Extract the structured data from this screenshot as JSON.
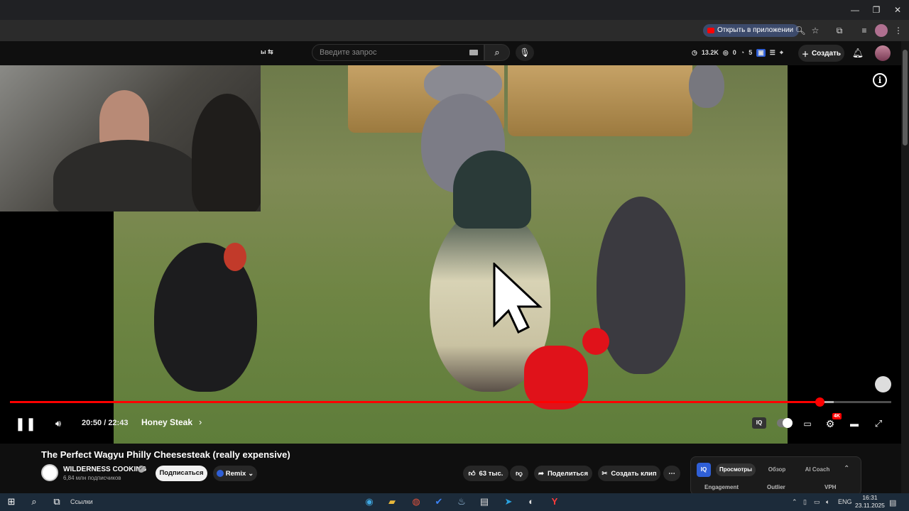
{
  "browser": {
    "open_in_app_label": "Открыть в приложении",
    "window_buttons": [
      "—",
      "❐",
      "✕"
    ]
  },
  "masthead": {
    "search_placeholder": "Введите запрос",
    "stats": {
      "views": "13.2K",
      "dislikes": "0",
      "comments": "5"
    },
    "create_label": "Создать",
    "crumb_text": "ы ⇆"
  },
  "player": {
    "time_current": "20:50",
    "time_total": "22:43",
    "time_separator": " / ",
    "chapter": "Honey Steak",
    "progress_fraction": 0.919,
    "buffer_fraction": 0.935,
    "quality_badge": "4K",
    "iq_label": "IQ",
    "info_icon_glyph": "i"
  },
  "video_info": {
    "title": "The Perfect Wagyu Philly Cheesesteak (really expensive)",
    "channel_name": "WILDERNESS COOKING",
    "subscribers": "6,84 млн подписчиков",
    "subscribe_label": "Подписаться",
    "remix_label": "Remix",
    "likes": "63 тыс.",
    "share_label": "Поделиться",
    "clip_label": "Создать клип"
  },
  "vidiq": {
    "logo": "IQ",
    "tabs": [
      "Просмотры",
      "Обзор",
      "AI Coach"
    ],
    "columns": [
      "Engagement",
      "Outlier",
      "VPH"
    ]
  },
  "taskbar": {
    "links_label": "Ссылки",
    "language": "ENG",
    "time": "16:31",
    "date": "23.11.2025"
  },
  "icons": {
    "play_pause": "pause-icon",
    "volume": "volume-icon",
    "settings": "gear-icon",
    "fullscreen": "fullscreen-icon"
  },
  "colors": {
    "progress": "#ff0000",
    "accent": "#2f5fd6"
  }
}
